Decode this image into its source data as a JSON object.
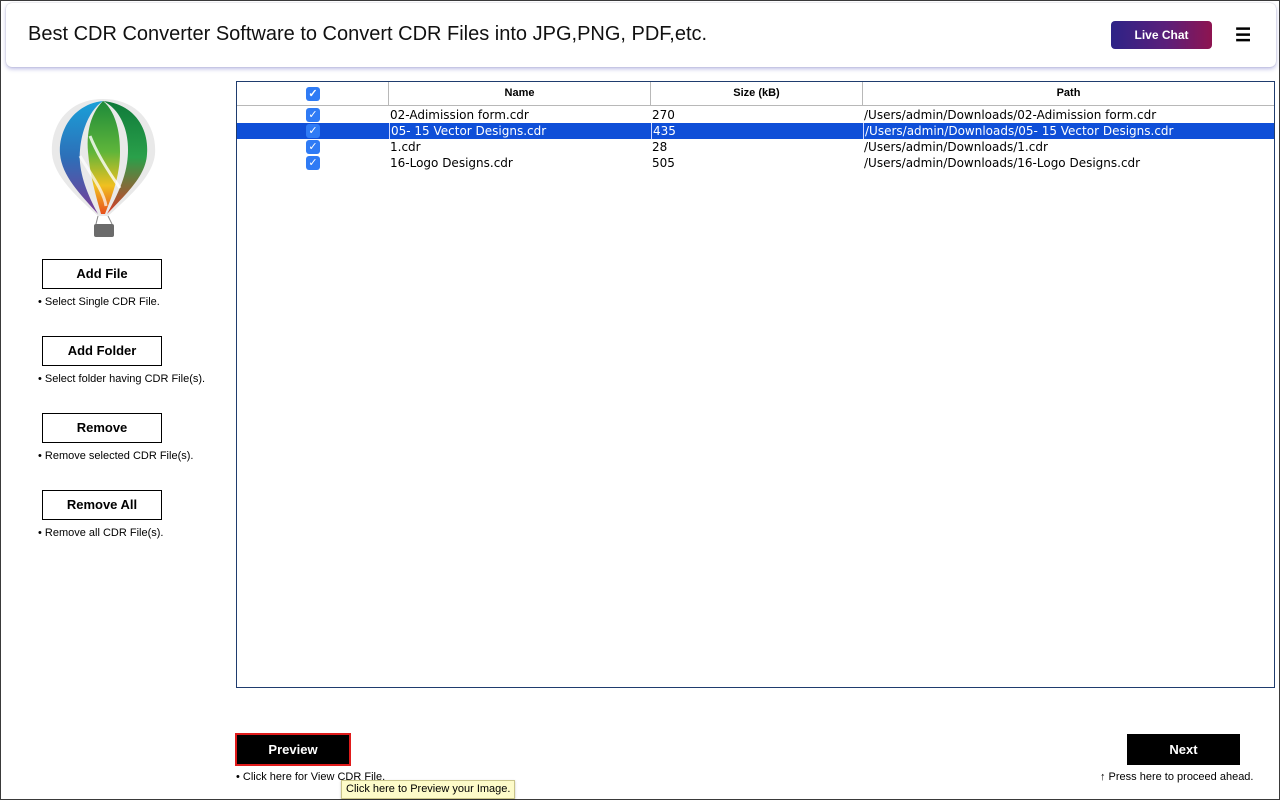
{
  "header": {
    "title": "Best CDR Converter Software to Convert CDR Files into JPG,PNG, PDF,etc.",
    "live_chat_label": "Live Chat",
    "menu_icon": "hamburger-menu-icon"
  },
  "sidebar": {
    "logo": "coreldraw-balloon-logo",
    "buttons": [
      {
        "label": "Add File",
        "hint": "• Select Single CDR File."
      },
      {
        "label": "Add Folder",
        "hint": "• Select folder having CDR File(s)."
      },
      {
        "label": "Remove",
        "hint": "• Remove selected CDR File(s)."
      },
      {
        "label": "Remove All",
        "hint": "• Remove all CDR File(s)."
      }
    ]
  },
  "table": {
    "select_all_checked": true,
    "columns": [
      "Name",
      "Size (kB)",
      "Path"
    ],
    "rows": [
      {
        "checked": true,
        "name": "02-Adimission form.cdr",
        "size": "270",
        "path": "/Users/admin/Downloads/02-Adimission form.cdr",
        "selected": false
      },
      {
        "checked": true,
        "name": "05- 15 Vector Designs.cdr",
        "size": "435",
        "path": "/Users/admin/Downloads/05- 15 Vector Designs.cdr",
        "selected": true
      },
      {
        "checked": true,
        "name": "1.cdr",
        "size": "28",
        "path": "/Users/admin/Downloads/1.cdr",
        "selected": false
      },
      {
        "checked": true,
        "name": "16-Logo Designs.cdr",
        "size": "505",
        "path": "/Users/admin/Downloads/16-Logo Designs.cdr",
        "selected": false
      }
    ]
  },
  "footer": {
    "preview_label": "Preview",
    "preview_hint": "• Click here for View CDR File.",
    "next_label": "Next",
    "next_hint": "↑ Press here to proceed ahead.",
    "tooltip": "Click here to Preview your Image."
  },
  "colors": {
    "selected_row": "#0f4fd8",
    "checkbox": "#2f7bf5",
    "live_chat_gradient": [
      "#2d2387",
      "#8e1450"
    ],
    "preview_border": "#e01b1b"
  }
}
